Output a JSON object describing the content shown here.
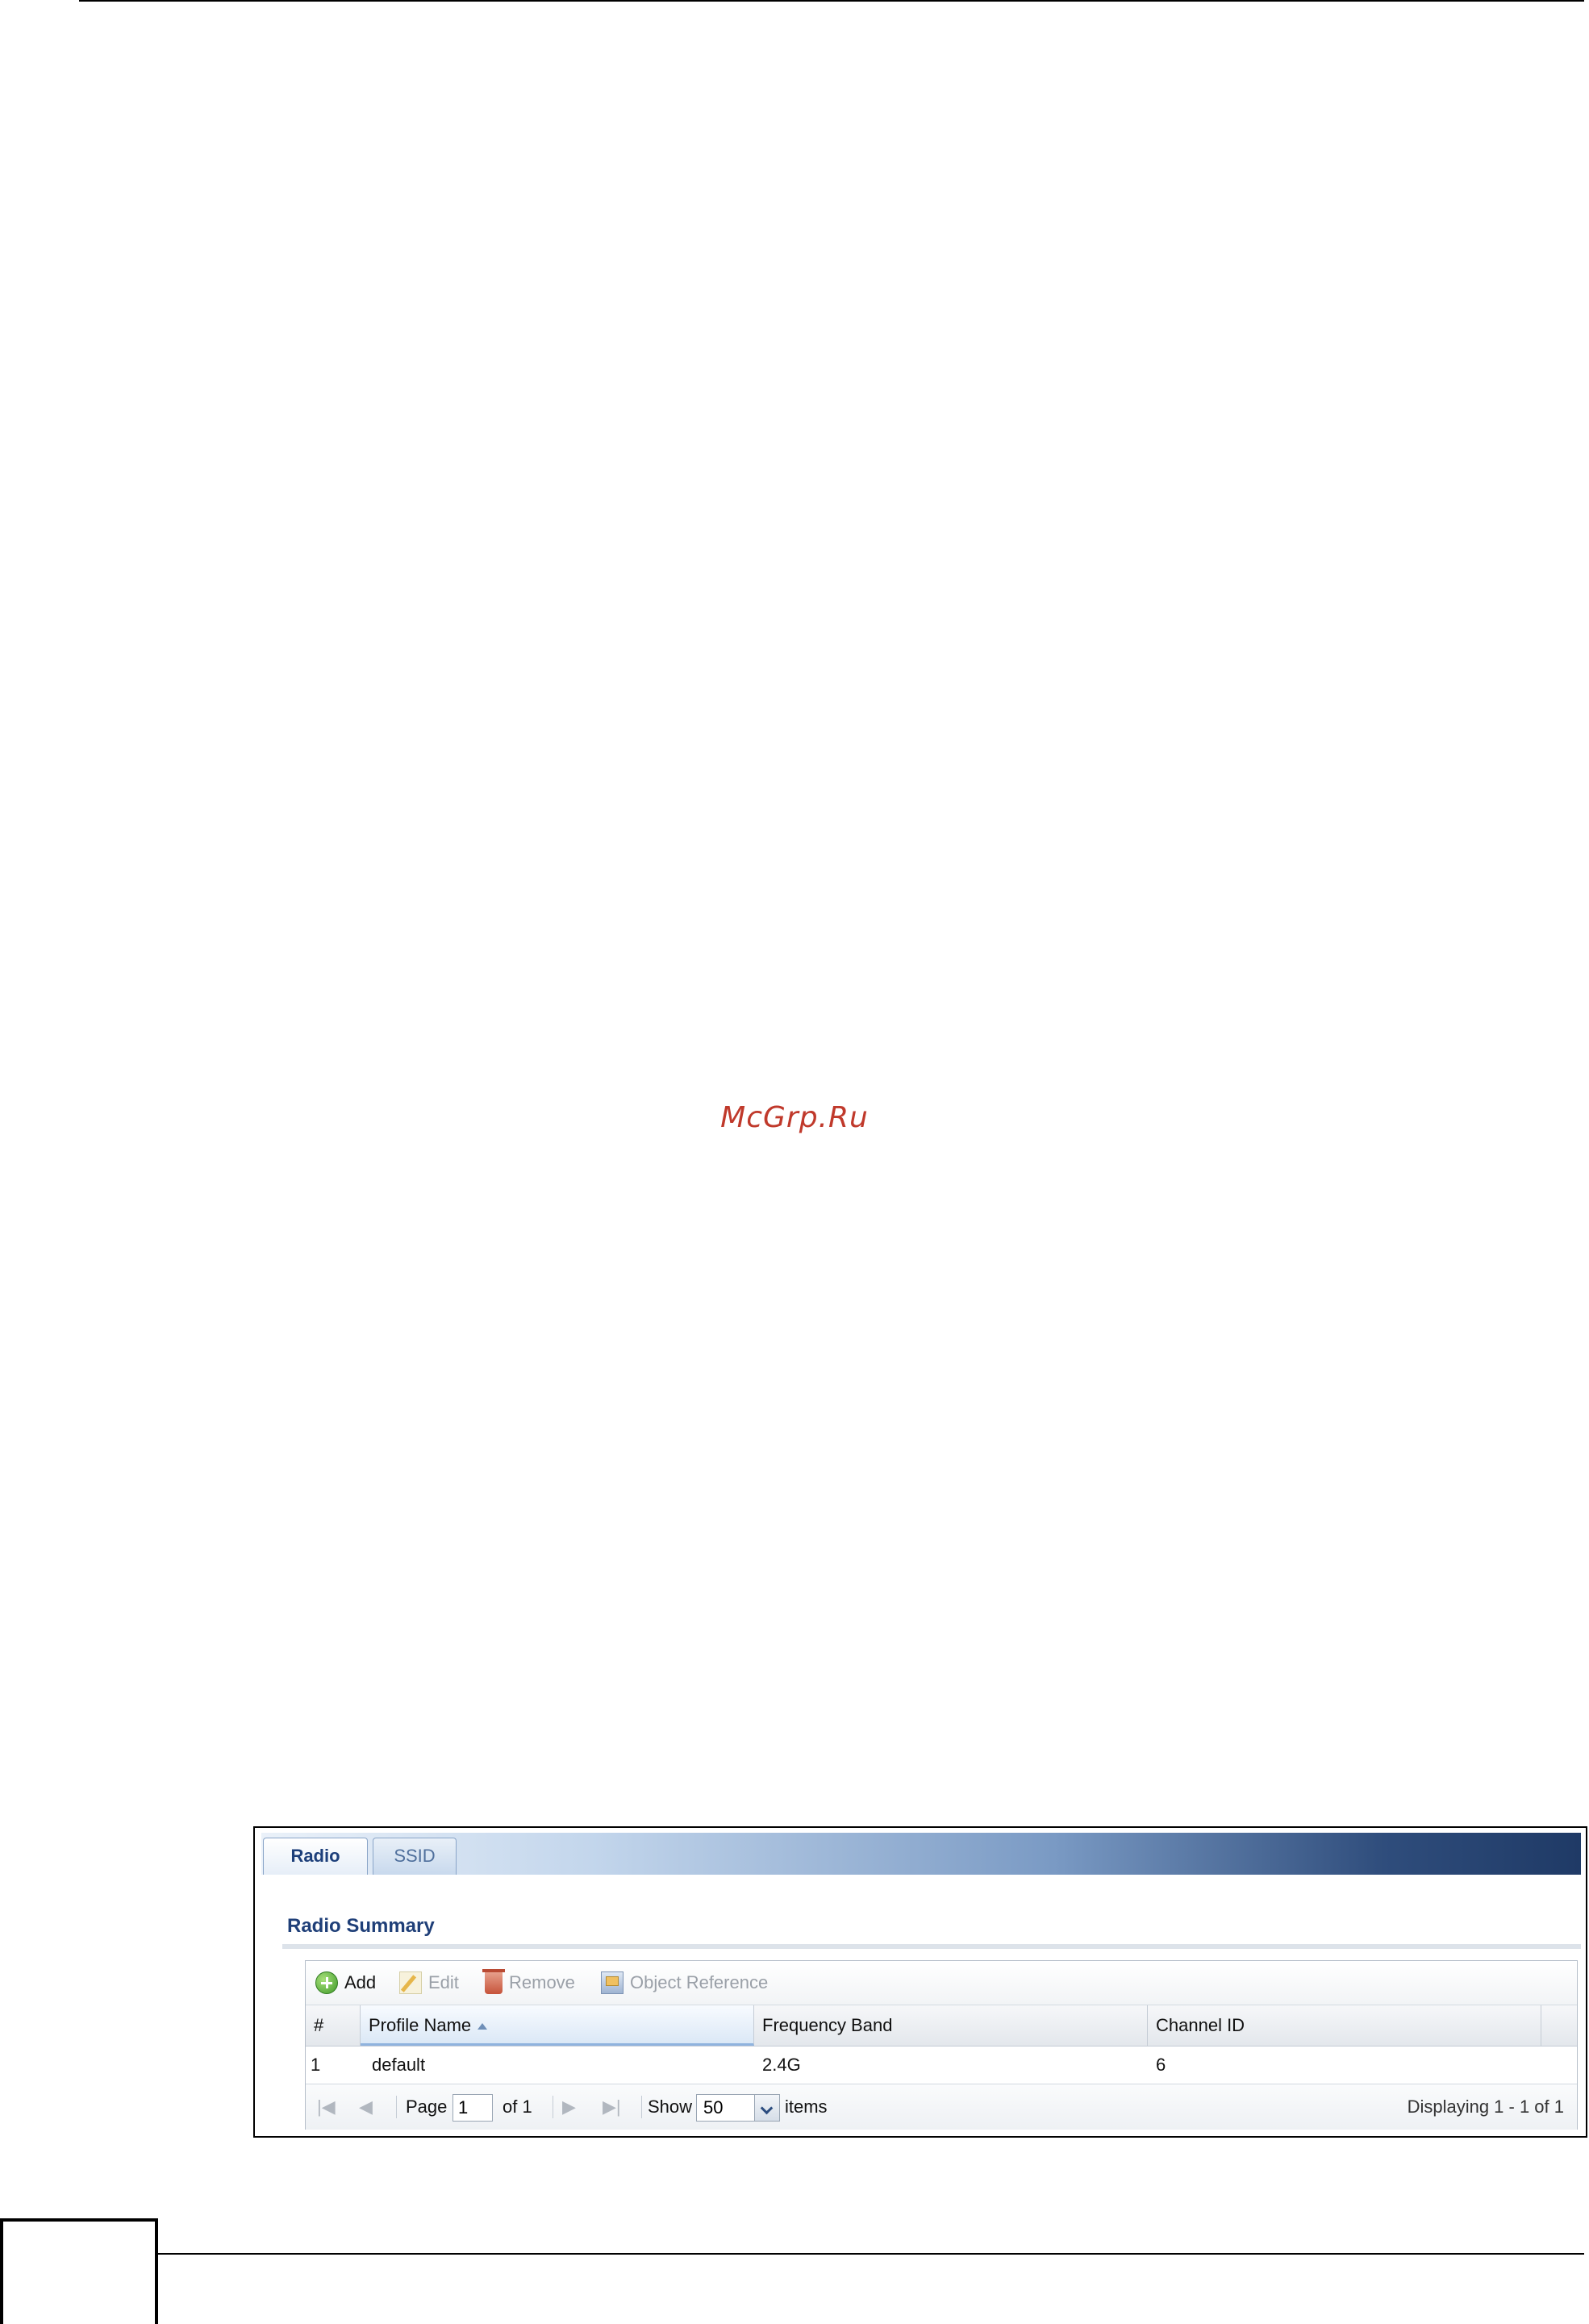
{
  "watermark": "McGrp.Ru",
  "tabs": {
    "radio": "Radio",
    "ssid": "SSID"
  },
  "section": {
    "title": "Radio Summary"
  },
  "toolbar": {
    "add": "Add",
    "edit": "Edit",
    "remove": "Remove",
    "object_reference": "Object Reference"
  },
  "table": {
    "columns": [
      "#",
      "Profile Name",
      "Frequency Band",
      "Channel ID"
    ],
    "sort_column": "Profile Name",
    "rows": [
      {
        "num": "1",
        "profile_name": "default",
        "frequency_band": "2.4G",
        "channel_id": "6"
      }
    ]
  },
  "pager": {
    "page_label": "Page",
    "page_value": "1",
    "of_label": "of 1",
    "show_label": "Show",
    "show_value": "50",
    "items_label": "items",
    "displaying": "Displaying 1 - 1 of 1"
  },
  "icons": {
    "add": "add-icon",
    "edit": "edit-icon",
    "remove": "trash-icon",
    "object_reference": "object-reference-icon",
    "first": "first-page-icon",
    "prev": "prev-page-icon",
    "next": "next-page-icon",
    "last": "last-page-icon",
    "dropdown": "chevron-down-icon"
  }
}
